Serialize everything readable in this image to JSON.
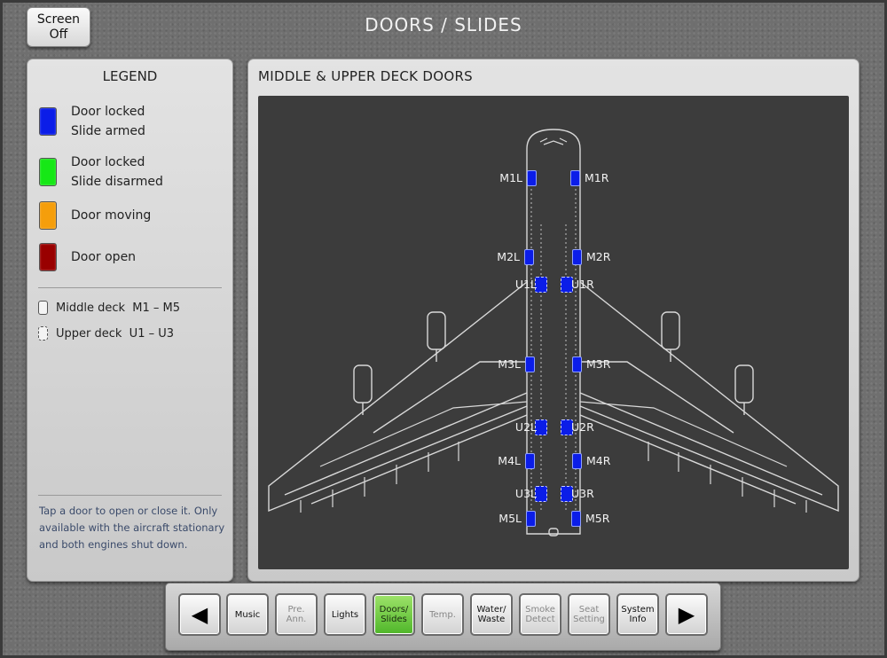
{
  "header": {
    "screen_off_label": "Screen Off",
    "title": "DOORS / SLIDES"
  },
  "legend": {
    "title": "LEGEND",
    "items": [
      {
        "line1": "Door locked",
        "line2": "Slide armed",
        "color": "#0b1de8"
      },
      {
        "line1": "Door locked",
        "line2": "Slide disarmed",
        "color": "#16e816"
      },
      {
        "line1": "Door moving",
        "line2": "",
        "color": "#f59e0b"
      },
      {
        "line1": "Door open",
        "line2": "",
        "color": "#990000"
      }
    ],
    "decks": [
      {
        "label": "Middle deck  M1 – M5",
        "style": "solid"
      },
      {
        "label": "Upper deck  U1 – U3",
        "style": "dashed"
      }
    ],
    "note": "Tap a door to open or close it. Only available with the aircraft stationary and both engines shut down."
  },
  "main": {
    "title": "MIDDLE & UPPER DECK DOORS",
    "doors": [
      {
        "label": "M1L",
        "deck": "middle",
        "status": "locked-armed"
      },
      {
        "label": "M1R",
        "deck": "middle",
        "status": "locked-armed"
      },
      {
        "label": "M2L",
        "deck": "middle",
        "status": "locked-armed"
      },
      {
        "label": "M2R",
        "deck": "middle",
        "status": "locked-armed"
      },
      {
        "label": "U1L",
        "deck": "upper",
        "status": "locked-armed"
      },
      {
        "label": "U1R",
        "deck": "upper",
        "status": "locked-armed"
      },
      {
        "label": "M3L",
        "deck": "middle",
        "status": "locked-armed"
      },
      {
        "label": "M3R",
        "deck": "middle",
        "status": "locked-armed"
      },
      {
        "label": "U2L",
        "deck": "upper",
        "status": "locked-armed"
      },
      {
        "label": "U2R",
        "deck": "upper",
        "status": "locked-armed"
      },
      {
        "label": "M4L",
        "deck": "middle",
        "status": "locked-armed"
      },
      {
        "label": "M4R",
        "deck": "middle",
        "status": "locked-armed"
      },
      {
        "label": "U3L",
        "deck": "upper",
        "status": "locked-armed"
      },
      {
        "label": "U3R",
        "deck": "upper",
        "status": "locked-armed"
      },
      {
        "label": "M5L",
        "deck": "middle",
        "status": "locked-armed"
      },
      {
        "label": "M5R",
        "deck": "middle",
        "status": "locked-armed"
      }
    ]
  },
  "nav": {
    "prev_icon": "left-arrow-icon",
    "next_icon": "right-arrow-icon",
    "buttons": [
      {
        "label": "Music",
        "state": "normal"
      },
      {
        "label": "Pre. Ann.",
        "state": "dim"
      },
      {
        "label": "Lights",
        "state": "normal"
      },
      {
        "label": "Doors/ Slides",
        "state": "active"
      },
      {
        "label": "Temp.",
        "state": "dim"
      },
      {
        "label": "Water/ Waste",
        "state": "normal"
      },
      {
        "label": "Smoke Detect",
        "state": "dim"
      },
      {
        "label": "Seat Setting",
        "state": "dim"
      },
      {
        "label": "System Info",
        "state": "normal"
      }
    ]
  }
}
